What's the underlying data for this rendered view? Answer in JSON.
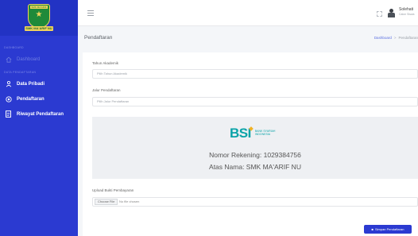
{
  "sidebar": {
    "logo_ribbon": "SMK MA'ARIF NU",
    "logo_text": "SMK MA'ARIF NU",
    "section_1": "Dashboard",
    "item_dashboard": "Dashboard",
    "section_2": "Data Pendaftaran",
    "items": [
      {
        "label": "Data Pribadi",
        "icon": "user-icon"
      },
      {
        "label": "Pendaftaran",
        "icon": "target-icon"
      },
      {
        "label": "Riwayat Pendaftaran",
        "icon": "document-icon"
      }
    ]
  },
  "topbar": {
    "user_name": "Solehati",
    "user_role": "Calon Siswa"
  },
  "page": {
    "title": "Pendaftaran",
    "breadcrumb": [
      "Dashboard",
      "Pendaftaran"
    ]
  },
  "form": {
    "tahun_label": "Tahun Akademik",
    "tahun_placeholder": "Pilih Tahun Akademik",
    "jalur_label": "Jalur Pendaftaran",
    "jalur_placeholder": "Pilih Jalur Pendaftaran",
    "bank_logo": "BSI",
    "bank_name_line1": "Bank Syariah",
    "bank_name_line2": "Indonesia",
    "rekening": "Nomor Rekening: 1029384756",
    "atas_nama": "Atas Nama: SMK MA'ARIF NU",
    "upload_label": "Upload Bukti Pembayaran",
    "choose_file": "Choose File",
    "no_file": "No file chosen",
    "save_button": "Simpan Pendaftaran"
  },
  "colors": {
    "sidebar": "#2b3ad1",
    "accent": "#2b3ad1",
    "bsi_teal": "#0aa3a8",
    "bsi_gold": "#f0b224"
  }
}
